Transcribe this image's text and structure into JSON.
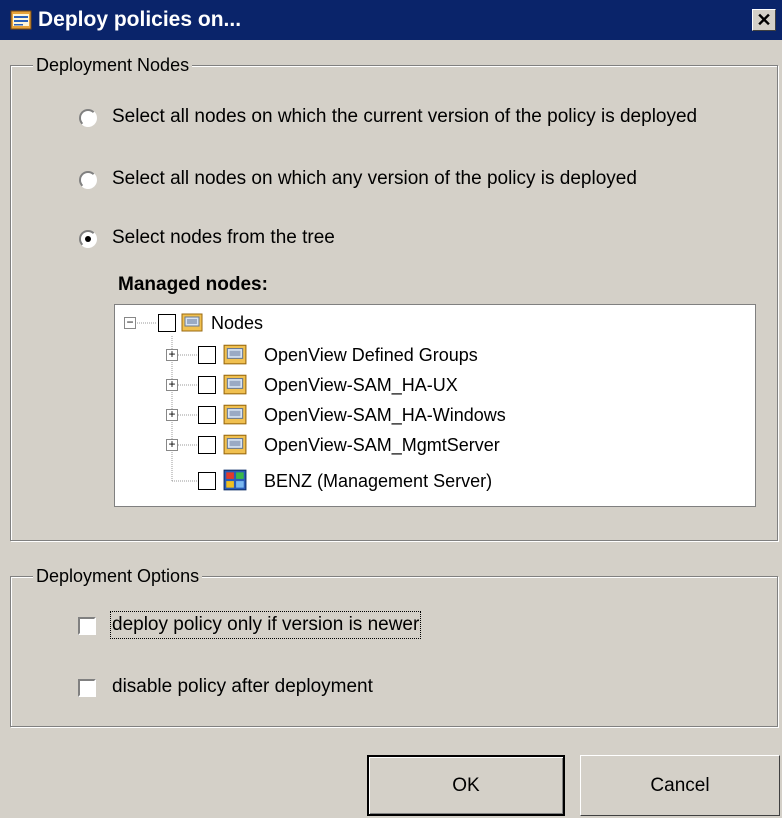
{
  "window": {
    "title": "Deploy policies on...",
    "title_icon": "policy-deploy-icon",
    "close_glyph": "✕",
    "titlebar_color": "#0a246a",
    "face_color": "#d4d0c8"
  },
  "deployment_nodes": {
    "legend": "Deployment Nodes",
    "options": [
      {
        "label": "Select all nodes on which the current version of the policy is deployed",
        "selected": false
      },
      {
        "label": "Select all nodes on which any version of the policy is deployed",
        "selected": false
      },
      {
        "label": "Select nodes from the tree",
        "selected": true
      }
    ],
    "managed_nodes_label": "Managed nodes:",
    "tree": {
      "root": {
        "label": "Nodes",
        "expanded": true,
        "checked": false,
        "icon": "node-folder-icon"
      },
      "children": [
        {
          "label": "OpenView Defined Groups",
          "expanded": false,
          "checked": false,
          "icon": "node-folder-icon"
        },
        {
          "label": "OpenView-SAM_HA-UX",
          "expanded": false,
          "checked": false,
          "icon": "node-folder-icon"
        },
        {
          "label": "OpenView-SAM_HA-Windows",
          "expanded": false,
          "checked": false,
          "icon": "node-folder-icon"
        },
        {
          "label": "OpenView-SAM_MgmtServer",
          "expanded": false,
          "checked": false,
          "icon": "node-folder-icon"
        },
        {
          "label": "BENZ (Management Server)",
          "expanded": null,
          "checked": false,
          "icon": "management-server-icon"
        }
      ]
    }
  },
  "deployment_options": {
    "legend": "Deployment Options",
    "options": [
      {
        "label": "deploy policy only if version is newer",
        "checked": false
      },
      {
        "label": "disable policy after deployment",
        "checked": false
      }
    ]
  },
  "buttons": {
    "ok": "OK",
    "cancel": "Cancel"
  }
}
